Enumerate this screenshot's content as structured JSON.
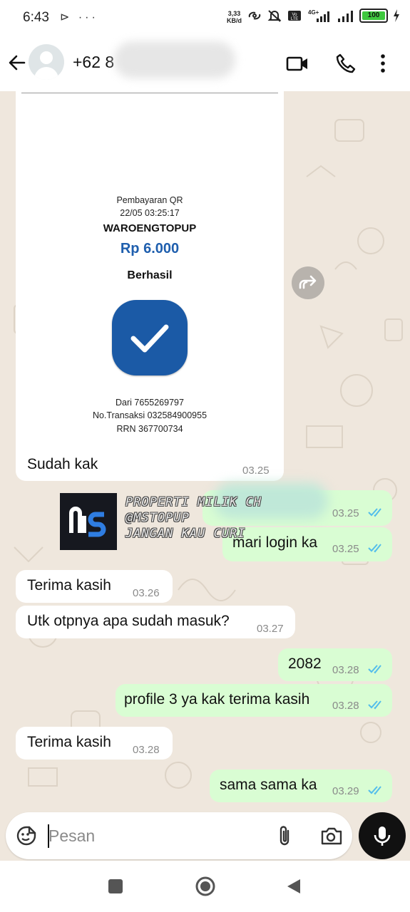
{
  "status_bar": {
    "time": "6:43",
    "left_icons": "⊳ ···",
    "net_speed_value": "3,33",
    "net_speed_unit": "KB/d",
    "network": "4G+",
    "battery_level": "100"
  },
  "header": {
    "contact_name": "+62 8",
    "icons": [
      "back-arrow-icon",
      "video-call-icon",
      "voice-call-icon",
      "more-vert-icon"
    ]
  },
  "receipt": {
    "title": "Pembayaran QR",
    "datetime": "22/05 03:25:17",
    "merchant": "WAROENGTOPUP",
    "amount": "Rp 6.000",
    "status": "Berhasil",
    "from": "Dari 7655269797",
    "transaction_no": "No.Transaksi 032584900955",
    "rrn": "RRN 367700734"
  },
  "watermark": {
    "logo_text": "MS",
    "line1": "PROPERTI MILIK CH",
    "line2": "@MSTOPUP",
    "line3": "JANGAN KAU CURI"
  },
  "messages": [
    {
      "dir": "in",
      "text": "Sudah kak",
      "time": "03.25"
    },
    {
      "dir": "out",
      "text": "",
      "time": "03.25",
      "status": "read"
    },
    {
      "dir": "out",
      "text": "mari login ka",
      "time": "03.25",
      "status": "read"
    },
    {
      "dir": "in",
      "text": "Terima kasih",
      "time": "03.26"
    },
    {
      "dir": "in",
      "text": "Utk otpnya apa sudah masuk?",
      "time": "03.27"
    },
    {
      "dir": "out",
      "text": "2082",
      "time": "03.28",
      "status": "read"
    },
    {
      "dir": "out",
      "text": "profile 3 ya kak terima kasih",
      "time": "03.28",
      "status": "read"
    },
    {
      "dir": "in",
      "text": "Terima kasih",
      "time": "03.28"
    },
    {
      "dir": "out",
      "text": "sama sama ka",
      "time": "03.29",
      "status": "read"
    }
  ],
  "composer": {
    "placeholder": "Pesan",
    "icons": [
      "sticker-icon",
      "attach-icon",
      "camera-icon",
      "mic-icon"
    ]
  },
  "colors": {
    "chat_bg": "#efe7dd",
    "incoming_bubble": "#ffffff",
    "outgoing_bubble": "#d9fdd3",
    "read_tick": "#53bdeb",
    "receipt_accent": "#1b5aa6"
  }
}
